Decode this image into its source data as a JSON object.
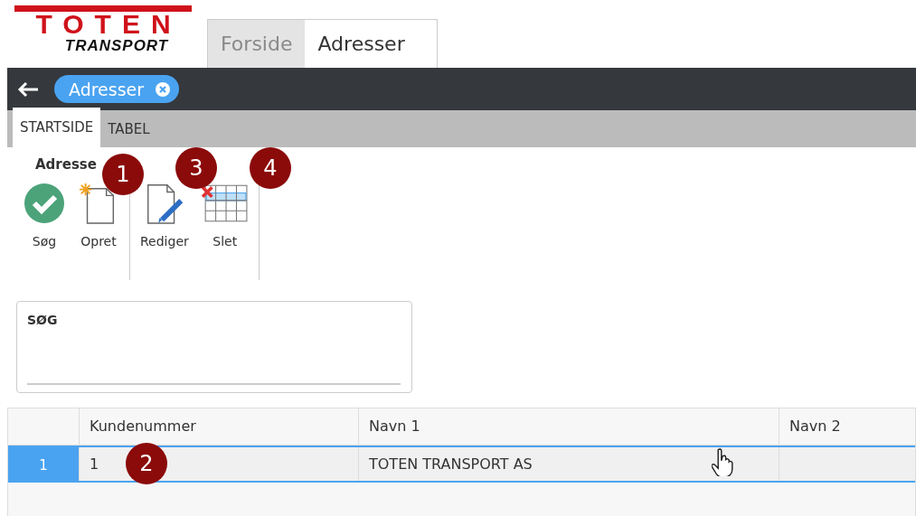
{
  "logo": {
    "top": "TOTEN",
    "bottom": "TRANSPORT"
  },
  "page_tabs": [
    {
      "label": "Forside",
      "selected": false
    },
    {
      "label": "Adresser",
      "selected": true
    }
  ],
  "breadcrumb": {
    "label": "Adresser"
  },
  "ribbon_tabs": [
    {
      "label": "STARTSIDE",
      "selected": true
    },
    {
      "label": "TABEL",
      "selected": false
    }
  ],
  "ribbon": {
    "groups": [
      {
        "label": "Adresse",
        "buttons": [
          {
            "label": "Søg",
            "kind": "search"
          },
          {
            "label": "Opret",
            "kind": "create"
          }
        ]
      },
      {
        "buttons": [
          {
            "label": "Rediger",
            "kind": "edit"
          },
          {
            "label": "Slet",
            "kind": "delete"
          }
        ]
      }
    ]
  },
  "search": {
    "label": "SØG"
  },
  "table": {
    "columns": [
      "Kundenummer",
      "Navn 1",
      "Navn 2"
    ],
    "rows": [
      {
        "number": "1",
        "selected": true,
        "cells": [
          "1",
          "TOTEN TRANSPORT AS"
        ]
      }
    ]
  },
  "callouts": [
    "1",
    "3",
    "4",
    "2"
  ]
}
